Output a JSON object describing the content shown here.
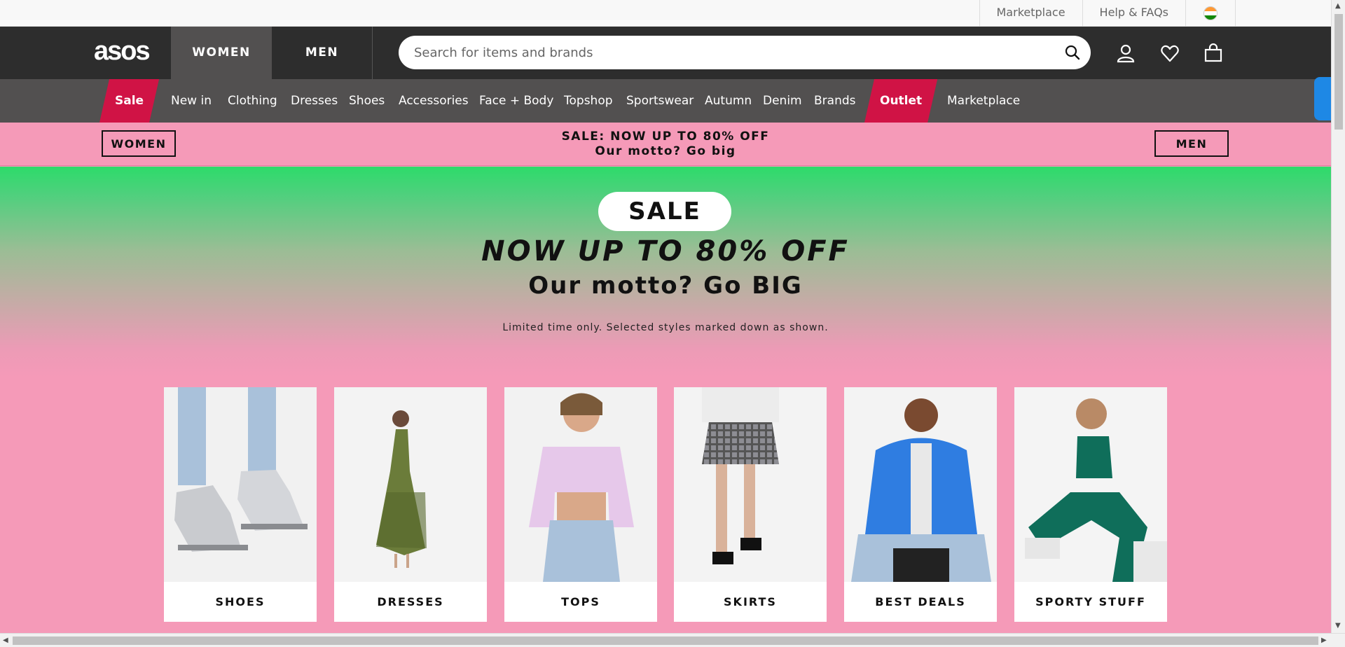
{
  "util": {
    "links": [
      "Marketplace",
      "Help & FAQs"
    ],
    "flag_icon": "india-flag-icon"
  },
  "header": {
    "logo": "asos",
    "tabs": [
      "WOMEN",
      "MEN"
    ],
    "search_placeholder": "Search for items and brands",
    "icons": [
      "search-icon",
      "account-icon",
      "heart-icon",
      "bag-icon"
    ]
  },
  "nav": {
    "items": [
      "Sale",
      "New in",
      "Clothing",
      "Dresses",
      "Shoes",
      "Accessories",
      "Face + Body",
      "Topshop",
      "Sportswear",
      "Autumn",
      "Denim",
      "Brands",
      "Outlet",
      "Marketplace"
    ]
  },
  "promo": {
    "left_button": "WOMEN",
    "right_button": "MEN",
    "line1": "SALE: NOW UP TO 80% OFF",
    "line2": "Our motto? Go big"
  },
  "hero": {
    "badge": "SALE",
    "headline": "NOW UP TO 80% OFF",
    "subheadline": "Our motto? Go BIG",
    "note": "Limited time only. Selected styles marked down as shown."
  },
  "cards": [
    {
      "label": "SHOES"
    },
    {
      "label": "DRESSES"
    },
    {
      "label": "TOPS"
    },
    {
      "label": "SKIRTS"
    },
    {
      "label": "BEST DEALS"
    },
    {
      "label": "SPORTY STUFF"
    }
  ],
  "colors": {
    "header_bg": "#2d2d2d",
    "nav_bg": "#525050",
    "sale_red": "#d01345",
    "pink": "#f59ab8",
    "green": "#2ddb6a"
  }
}
